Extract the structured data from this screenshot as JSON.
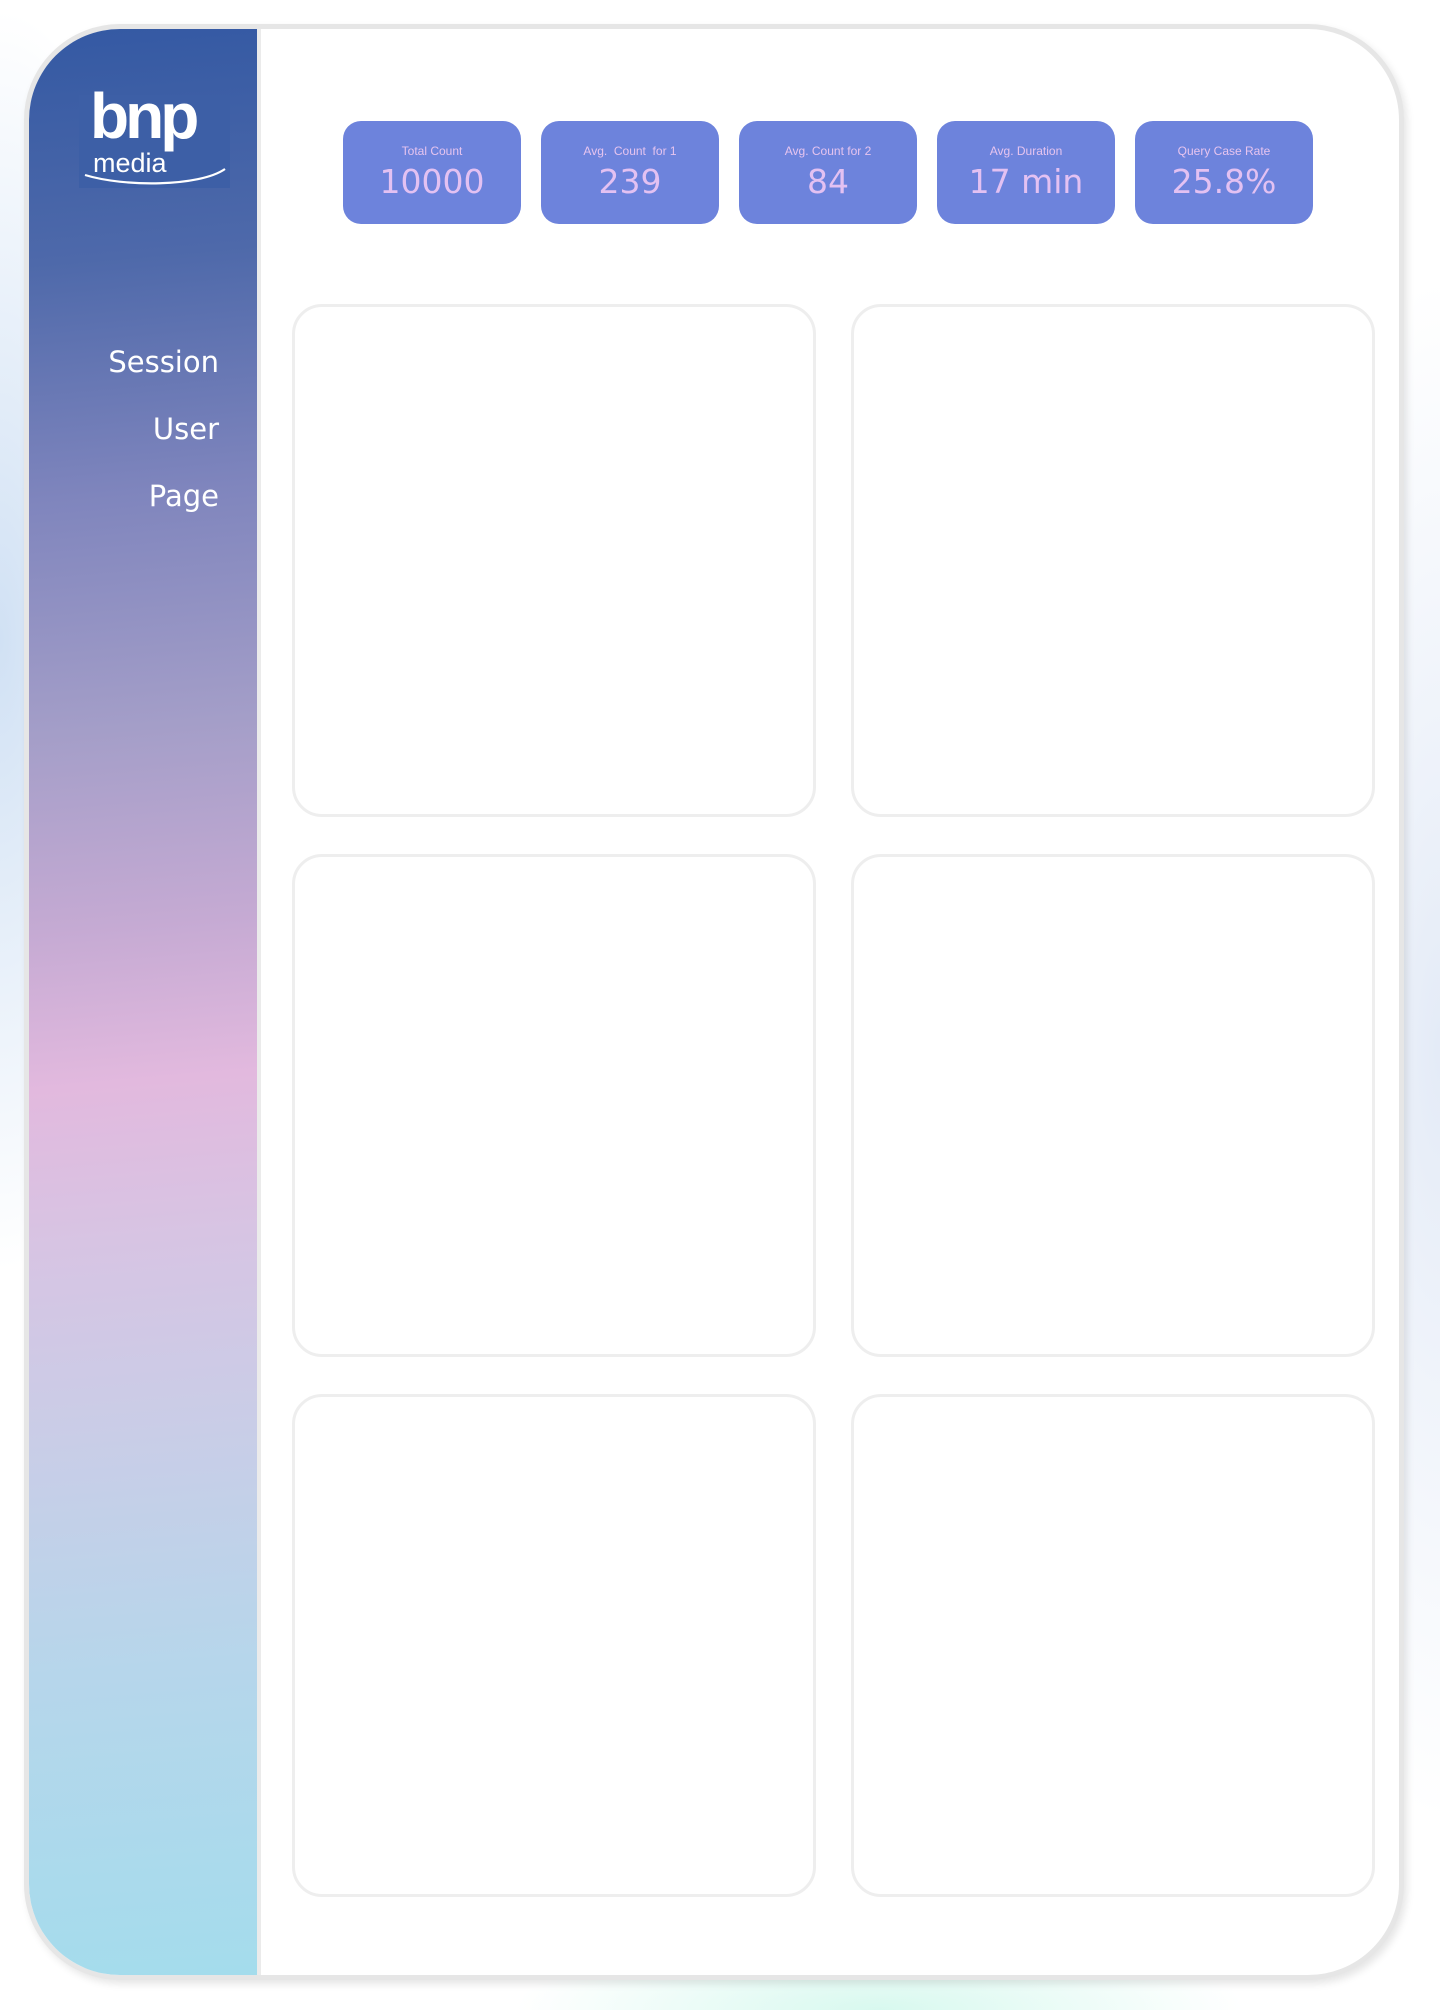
{
  "brand": {
    "logo_main": "bnp",
    "logo_sub": "media"
  },
  "nav": {
    "items": [
      {
        "label": "Session"
      },
      {
        "label": "User"
      },
      {
        "label": "Page"
      }
    ]
  },
  "kpis": [
    {
      "label": "Total Count",
      "value": "10000"
    },
    {
      "label": "Avg.  Count  for 1",
      "value": "239"
    },
    {
      "label": "Avg. Count for 2",
      "value": "84"
    },
    {
      "label": "Avg. Duration",
      "value": "17 min"
    },
    {
      "label": "Query Case Rate",
      "value": "25.8%"
    }
  ],
  "colors": {
    "kpi_card": "#6d83dc",
    "kpi_text": "#e3c1f2",
    "sidebar_top": "#3459a3",
    "sidebar_bottom": "#a4dcec"
  }
}
